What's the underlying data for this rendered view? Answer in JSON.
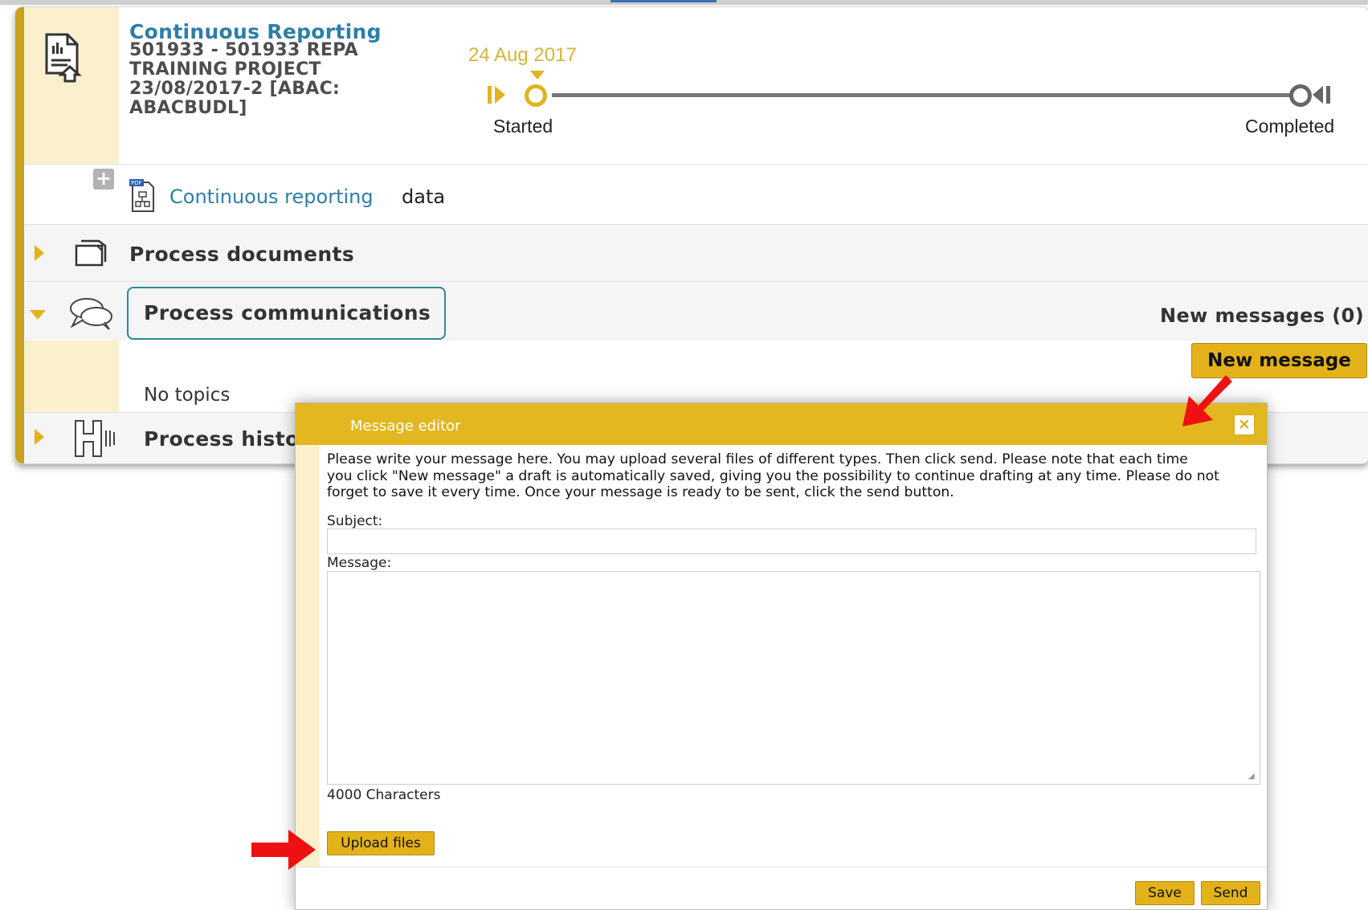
{
  "process": {
    "title": "Continuous Reporting",
    "subtitle_lines": [
      "501933 - 501933 REPA",
      "TRAINING PROJECT",
      "23/08/2017-2 [ABAC:",
      "ABACBUDL]"
    ]
  },
  "timeline": {
    "date": "24 Aug 2017",
    "start_label": "Started",
    "end_label": "Completed"
  },
  "data_row": {
    "link_text": "Continuous reporting",
    "suffix": "data"
  },
  "sections": {
    "documents": "Process documents",
    "communications": "Process communications",
    "history": "Process histor"
  },
  "communications": {
    "new_messages": "New messages (0)",
    "new_message_button": "New message",
    "no_topics": "No topics"
  },
  "modal": {
    "title": "Message editor",
    "close_glyph": "×",
    "intro_lines": [
      "Please write your message here. You may upload several files of different types. Then click send. Please note that each time",
      "you click \"New message\" a draft is automatically saved, giving you the possibility to continue drafting at any time. Please do not",
      "forget to save it every time. Once your message is ready to be sent, click the send button."
    ],
    "subject_label": "Subject:",
    "subject_value": "",
    "message_label": "Message:",
    "message_value": "",
    "char_count": "4000 Characters",
    "upload_button": "Upload files",
    "save_button": "Save",
    "send_button": "Send"
  },
  "colors": {
    "accent": "#e3b21a",
    "link": "#2e7ea8",
    "highlight_border": "#2b8c92",
    "arrow": "#ee1111"
  }
}
